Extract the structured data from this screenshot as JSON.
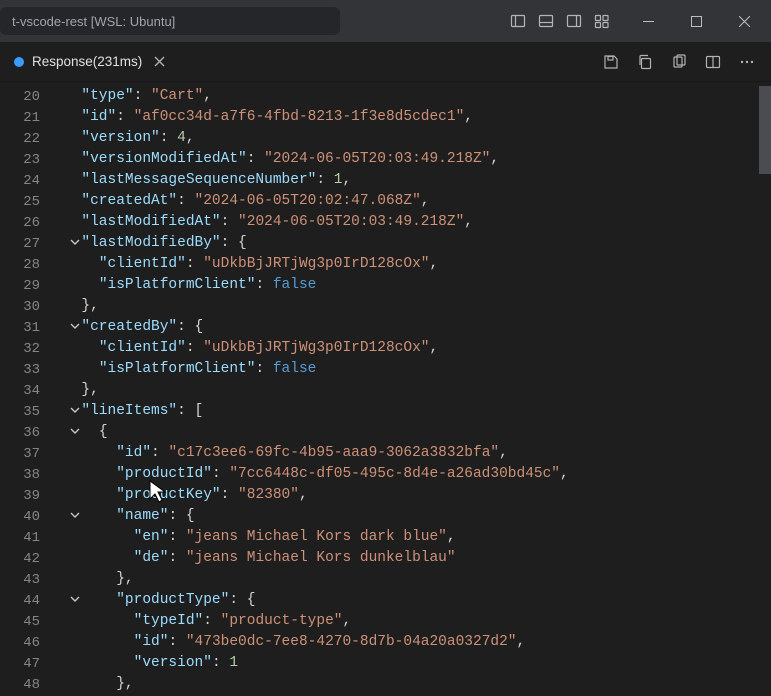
{
  "titleBar": {
    "title": "t-vscode-rest [WSL: Ubuntu]"
  },
  "tab": {
    "label": "Response(231ms)"
  },
  "codeLines": [
    {
      "n": 20,
      "fold": false,
      "indent": 2,
      "segs": [
        [
          "key",
          "\"type\""
        ],
        [
          "pun",
          ": "
        ],
        [
          "str",
          "\"Cart\""
        ],
        [
          "pun",
          ","
        ]
      ]
    },
    {
      "n": 21,
      "fold": false,
      "indent": 2,
      "segs": [
        [
          "key",
          "\"id\""
        ],
        [
          "pun",
          ": "
        ],
        [
          "str",
          "\"af0cc34d-a7f6-4fbd-8213-1f3e8d5cdec1\""
        ],
        [
          "pun",
          ","
        ]
      ]
    },
    {
      "n": 22,
      "fold": false,
      "indent": 2,
      "segs": [
        [
          "key",
          "\"version\""
        ],
        [
          "pun",
          ": "
        ],
        [
          "num",
          "4"
        ],
        [
          "pun",
          ","
        ]
      ]
    },
    {
      "n": 23,
      "fold": false,
      "indent": 2,
      "segs": [
        [
          "key",
          "\"versionModifiedAt\""
        ],
        [
          "pun",
          ": "
        ],
        [
          "str",
          "\"2024-06-05T20:03:49.218Z\""
        ],
        [
          "pun",
          ","
        ]
      ]
    },
    {
      "n": 24,
      "fold": false,
      "indent": 2,
      "segs": [
        [
          "key",
          "\"lastMessageSequenceNumber\""
        ],
        [
          "pun",
          ": "
        ],
        [
          "num",
          "1"
        ],
        [
          "pun",
          ","
        ]
      ]
    },
    {
      "n": 25,
      "fold": false,
      "indent": 2,
      "segs": [
        [
          "key",
          "\"createdAt\""
        ],
        [
          "pun",
          ": "
        ],
        [
          "str",
          "\"2024-06-05T20:02:47.068Z\""
        ],
        [
          "pun",
          ","
        ]
      ]
    },
    {
      "n": 26,
      "fold": false,
      "indent": 2,
      "segs": [
        [
          "key",
          "\"lastModifiedAt\""
        ],
        [
          "pun",
          ": "
        ],
        [
          "str",
          "\"2024-06-05T20:03:49.218Z\""
        ],
        [
          "pun",
          ","
        ]
      ]
    },
    {
      "n": 27,
      "fold": true,
      "indent": 2,
      "segs": [
        [
          "key",
          "\"lastModifiedBy\""
        ],
        [
          "pun",
          ": {"
        ]
      ]
    },
    {
      "n": 28,
      "fold": false,
      "indent": 4,
      "segs": [
        [
          "key",
          "\"clientId\""
        ],
        [
          "pun",
          ": "
        ],
        [
          "str",
          "\"uDkbBjJRTjWg3p0IrD128cOx\""
        ],
        [
          "pun",
          ","
        ]
      ]
    },
    {
      "n": 29,
      "fold": false,
      "indent": 4,
      "segs": [
        [
          "key",
          "\"isPlatformClient\""
        ],
        [
          "pun",
          ": "
        ],
        [
          "bool",
          "false"
        ]
      ]
    },
    {
      "n": 30,
      "fold": false,
      "indent": 2,
      "segs": [
        [
          "pun",
          "},"
        ]
      ]
    },
    {
      "n": 31,
      "fold": true,
      "indent": 2,
      "segs": [
        [
          "key",
          "\"createdBy\""
        ],
        [
          "pun",
          ": {"
        ]
      ]
    },
    {
      "n": 32,
      "fold": false,
      "indent": 4,
      "segs": [
        [
          "key",
          "\"clientId\""
        ],
        [
          "pun",
          ": "
        ],
        [
          "str",
          "\"uDkbBjJRTjWg3p0IrD128cOx\""
        ],
        [
          "pun",
          ","
        ]
      ]
    },
    {
      "n": 33,
      "fold": false,
      "indent": 4,
      "segs": [
        [
          "key",
          "\"isPlatformClient\""
        ],
        [
          "pun",
          ": "
        ],
        [
          "bool",
          "false"
        ]
      ]
    },
    {
      "n": 34,
      "fold": false,
      "indent": 2,
      "segs": [
        [
          "pun",
          "},"
        ]
      ]
    },
    {
      "n": 35,
      "fold": true,
      "indent": 2,
      "segs": [
        [
          "key",
          "\"lineItems\""
        ],
        [
          "pun",
          ": ["
        ]
      ]
    },
    {
      "n": 36,
      "fold": true,
      "indent": 4,
      "segs": [
        [
          "pun",
          "{"
        ]
      ]
    },
    {
      "n": 37,
      "fold": false,
      "indent": 6,
      "segs": [
        [
          "key",
          "\"id\""
        ],
        [
          "pun",
          ": "
        ],
        [
          "str",
          "\"c17c3ee6-69fc-4b95-aaa9-3062a3832bfa\""
        ],
        [
          "pun",
          ","
        ]
      ]
    },
    {
      "n": 38,
      "fold": false,
      "indent": 6,
      "segs": [
        [
          "key",
          "\"productId\""
        ],
        [
          "pun",
          ": "
        ],
        [
          "str",
          "\"7cc6448c-df05-495c-8d4e-a26ad30bd45c\""
        ],
        [
          "pun",
          ","
        ]
      ]
    },
    {
      "n": 39,
      "fold": false,
      "indent": 6,
      "segs": [
        [
          "key",
          "\"productKey\""
        ],
        [
          "pun",
          ": "
        ],
        [
          "str",
          "\"82380\""
        ],
        [
          "pun",
          ","
        ]
      ]
    },
    {
      "n": 40,
      "fold": true,
      "indent": 6,
      "segs": [
        [
          "key",
          "\"name\""
        ],
        [
          "pun",
          ": {"
        ]
      ]
    },
    {
      "n": 41,
      "fold": false,
      "indent": 8,
      "segs": [
        [
          "key",
          "\"en\""
        ],
        [
          "pun",
          ": "
        ],
        [
          "str",
          "\"jeans Michael Kors dark blue\""
        ],
        [
          "pun",
          ","
        ]
      ]
    },
    {
      "n": 42,
      "fold": false,
      "indent": 8,
      "segs": [
        [
          "key",
          "\"de\""
        ],
        [
          "pun",
          ": "
        ],
        [
          "str",
          "\"jeans Michael Kors dunkelblau\""
        ]
      ]
    },
    {
      "n": 43,
      "fold": false,
      "indent": 6,
      "segs": [
        [
          "pun",
          "},"
        ]
      ]
    },
    {
      "n": 44,
      "fold": true,
      "indent": 6,
      "segs": [
        [
          "key",
          "\"productType\""
        ],
        [
          "pun",
          ": {"
        ]
      ]
    },
    {
      "n": 45,
      "fold": false,
      "indent": 8,
      "segs": [
        [
          "key",
          "\"typeId\""
        ],
        [
          "pun",
          ": "
        ],
        [
          "str",
          "\"product-type\""
        ],
        [
          "pun",
          ","
        ]
      ]
    },
    {
      "n": 46,
      "fold": false,
      "indent": 8,
      "segs": [
        [
          "key",
          "\"id\""
        ],
        [
          "pun",
          ": "
        ],
        [
          "str",
          "\"473be0dc-7ee8-4270-8d7b-04a20a0327d2\""
        ],
        [
          "pun",
          ","
        ]
      ]
    },
    {
      "n": 47,
      "fold": false,
      "indent": 8,
      "segs": [
        [
          "key",
          "\"version\""
        ],
        [
          "pun",
          ": "
        ],
        [
          "num",
          "1"
        ]
      ]
    },
    {
      "n": 48,
      "fold": false,
      "indent": 6,
      "segs": [
        [
          "pun",
          "},"
        ]
      ]
    }
  ]
}
